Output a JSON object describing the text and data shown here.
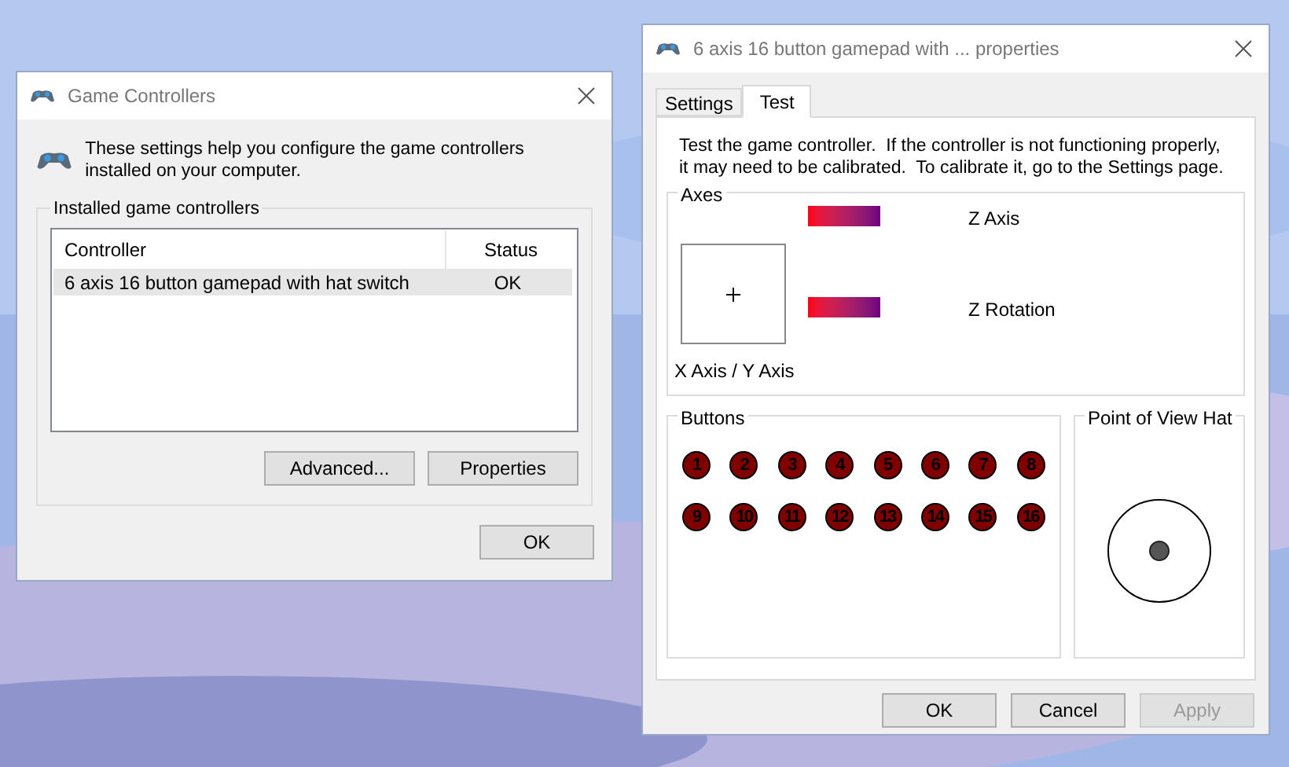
{
  "game_controllers": {
    "title": "Game Controllers",
    "intro": "These settings help you configure the game controllers installed on your computer.",
    "group_label": "Installed game controllers",
    "columns": [
      "Controller",
      "Status"
    ],
    "rows": [
      {
        "cells": [
          "6 axis 16 button gamepad with hat switch",
          "OK"
        ],
        "selected": true
      }
    ],
    "buttons": [
      {
        "label": "Advanced..."
      },
      {
        "label": "Properties"
      }
    ],
    "ok": "OK"
  },
  "properties": {
    "title": "6 axis 16 button gamepad with ... properties",
    "tabs": [
      {
        "label": "Settings",
        "selected": false
      },
      {
        "label": "Test",
        "selected": true
      }
    ],
    "intro": "Test the game controller.  If the controller is not functioning properly, it may need to be calibrated.  To calibrate it, go to the Settings page.",
    "axes": {
      "label": "Axes",
      "xy_label": "X Axis / Y Axis",
      "bars": [
        {
          "label": "Z Axis"
        },
        {
          "label": "Z Rotation"
        }
      ]
    },
    "buttons_group": {
      "label": "Buttons",
      "buttons": [
        "1",
        "2",
        "3",
        "4",
        "5",
        "6",
        "7",
        "8",
        "9",
        "10",
        "11",
        "12",
        "13",
        "14",
        "15",
        "16"
      ]
    },
    "pov": {
      "label": "Point of View Hat"
    },
    "footer": [
      {
        "label": "OK",
        "disabled": false
      },
      {
        "label": "Cancel",
        "disabled": false
      },
      {
        "label": "Apply",
        "disabled": true
      }
    ]
  }
}
